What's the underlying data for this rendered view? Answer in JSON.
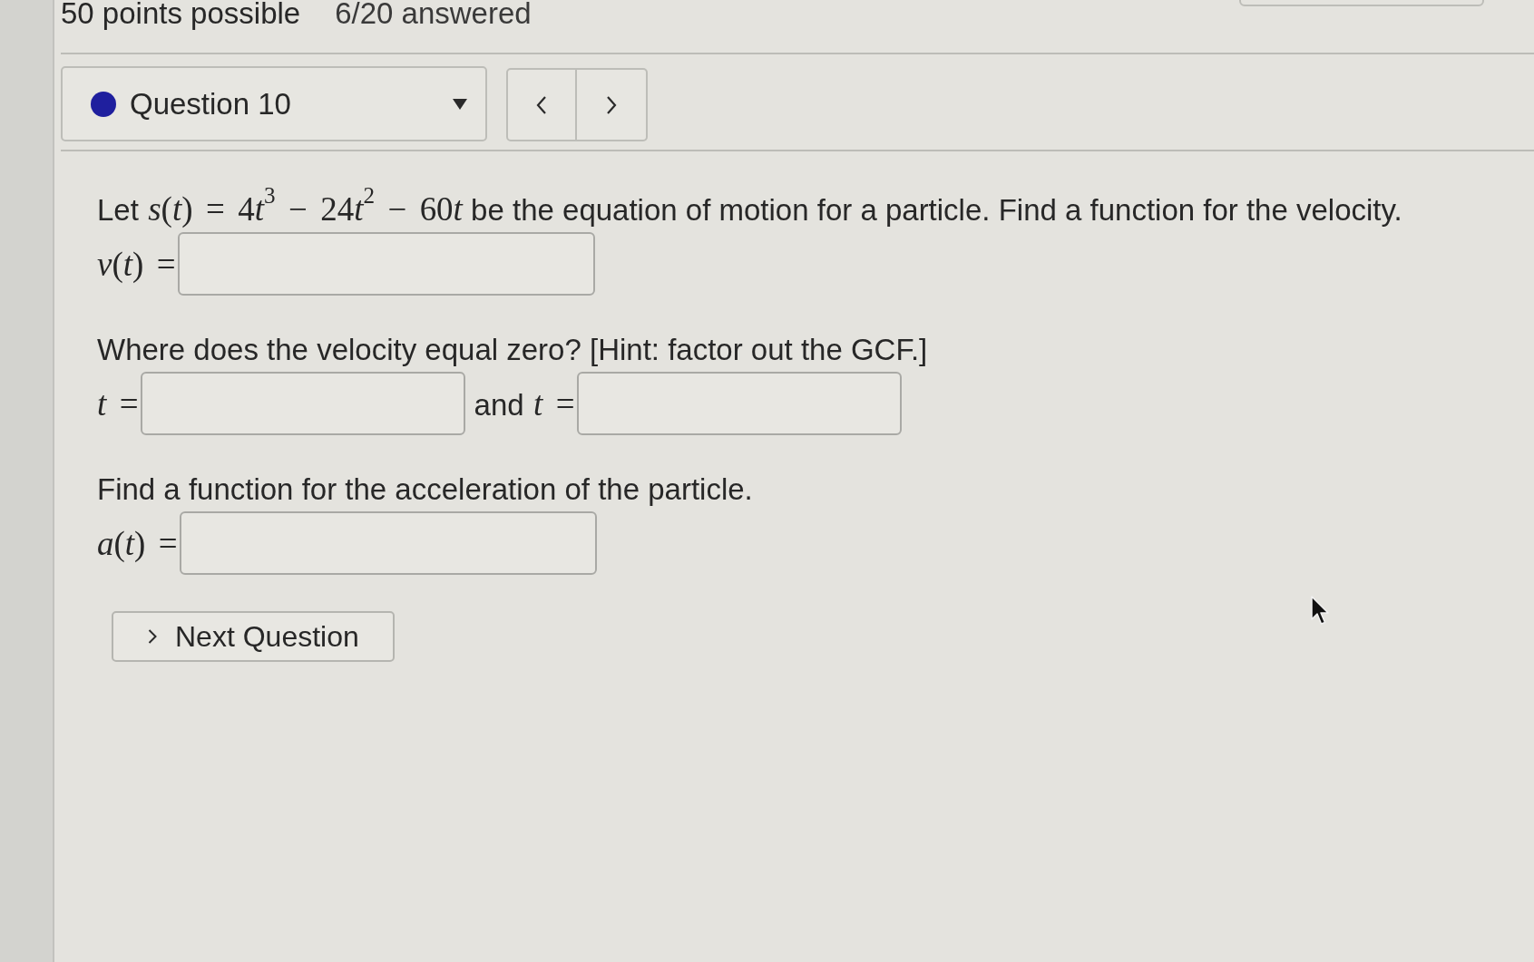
{
  "header": {
    "points": "50 points possible",
    "progress": "6/20 answered"
  },
  "question_nav": {
    "current": "Question 10",
    "color": "#1f1f9e"
  },
  "question": {
    "blocks": [
      {
        "prompt": [
          {
            "kind": "text",
            "text": "Let"
          },
          {
            "kind": "math",
            "pieces": [
              "*s*(*t*) = 4",
              "*t*$^{3}$ − 24",
              "*t*$^{2}$ − 60",
              "*t*"
            ]
          },
          {
            "kind": "text",
            "text": "be the equation of motion for a particle. Find a function for the velocity."
          }
        ],
        "answer_row": [
          {
            "kind": "label",
            "segments": [
              {
                "kind": "math",
                "pieces": [
                  "*v*(*t*) ="
                ]
              }
            ]
          },
          {
            "kind": "field"
          }
        ]
      },
      {
        "prompt": [
          {
            "kind": "text",
            "text": "Where does the velocity equal zero? [Hint: factor out the GCF.]"
          }
        ],
        "answer_row": [
          {
            "kind": "label",
            "segments": [
              {
                "kind": "math",
                "pieces": [
                  "*t* ="
                ]
              }
            ]
          },
          {
            "kind": "field"
          },
          {
            "kind": "label",
            "segments": [
              {
                "kind": "text",
                "text": "and"
              },
              {
                "kind": "math",
                "pieces": [
                  "*t* ="
                ]
              }
            ]
          },
          {
            "kind": "field"
          }
        ]
      },
      {
        "prompt": [
          {
            "kind": "text",
            "text": "Find a function for the acceleration of the particle."
          }
        ],
        "answer_row": [
          {
            "kind": "label",
            "segments": [
              {
                "kind": "math",
                "pieces": [
                  "*a*(*t*) ="
                ]
              }
            ]
          },
          {
            "kind": "field"
          }
        ]
      }
    ]
  },
  "next_button": {
    "label": "Next Question"
  }
}
